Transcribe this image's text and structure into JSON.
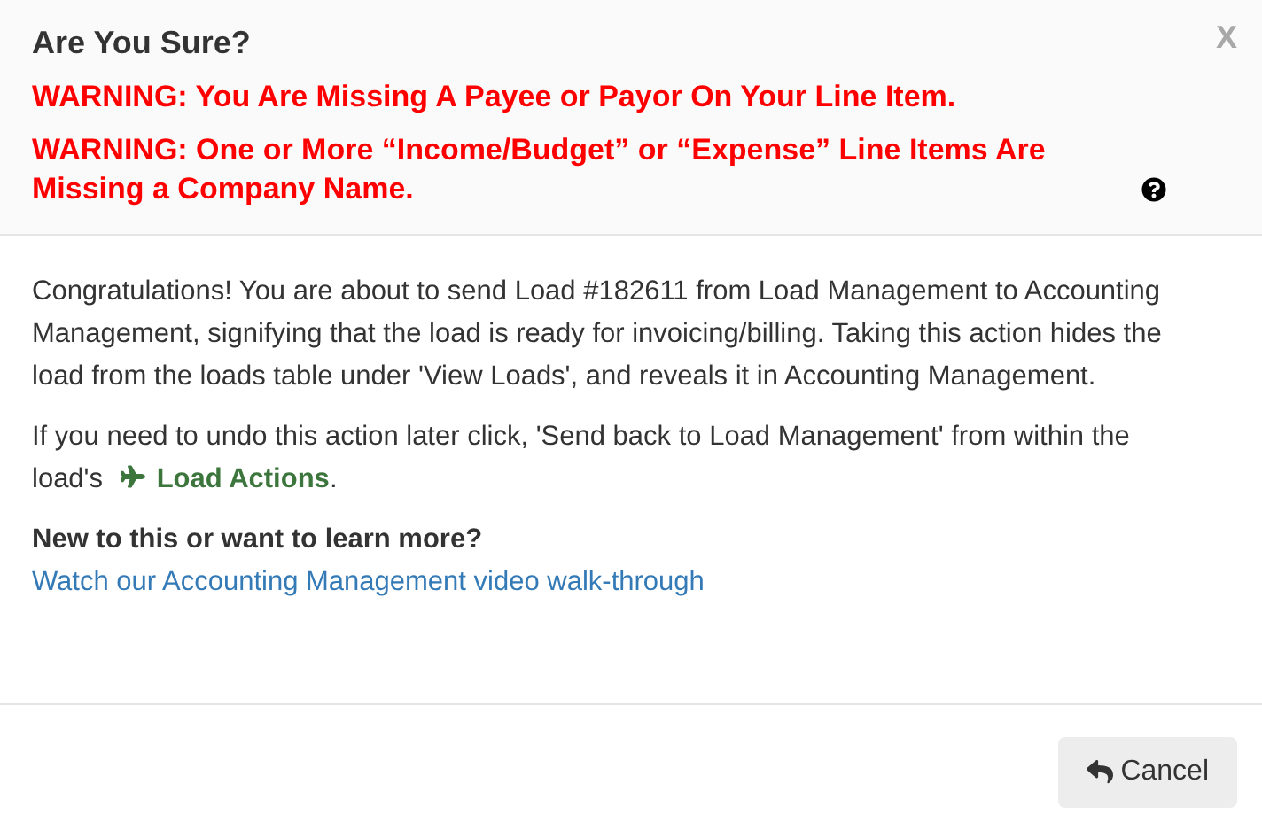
{
  "dialog": {
    "title": "Are You Sure?",
    "close": "X",
    "warnings": [
      "WARNING: You Are Missing A Payee or Payor On Your Line Item.",
      "WARNING: One or More “Income/Budget” or “Expense” Line Items Are Missing a Company Name."
    ],
    "body": [
      {
        "text": "Congratulations! You are about to send Load #182611 from Load Management to Accounting Management, signifying that the load is ready for invoicing/billing. Taking this action hides the load from the loads table under 'View Loads', and reveals it in Accounting Management."
      },
      {
        "text": "If you need to undo this action later click, 'Send back to Load Management' from within the load's",
        "link": "Load Actions",
        "after": "."
      }
    ],
    "learn_heading": "New to this or want to learn more?",
    "learn_link": "Watch our Accounting Management video walk-through",
    "buttons": [
      "Cancel"
    ]
  }
}
